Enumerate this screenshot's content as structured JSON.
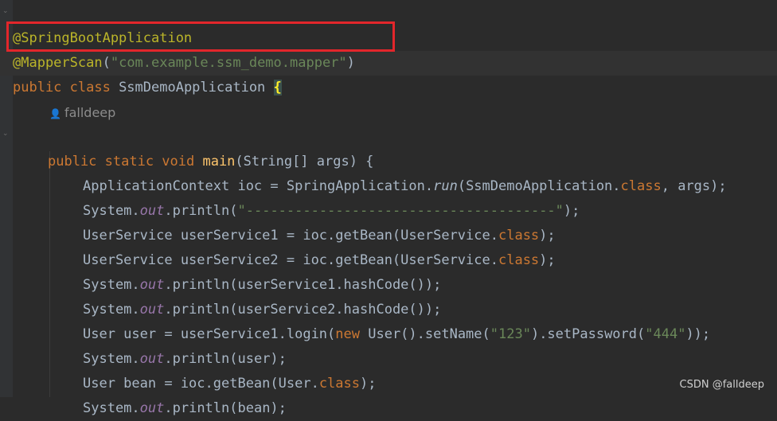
{
  "code": {
    "l1": [
      "@SpringBootApplication"
    ],
    "l2": [
      "@MapperScan",
      "(",
      "\"com.example.ssm_demo.mapper\"",
      ")"
    ],
    "l3": [
      "public class ",
      "SsmDemoApplication ",
      "{"
    ],
    "author": "falldeep",
    "l5": [
      "public static void ",
      "main",
      "(String[] args) {"
    ],
    "l6": [
      "ApplicationContext ioc = SpringApplication.",
      "run",
      "(SsmDemoApplication.",
      "class",
      ", args);"
    ],
    "l7": [
      "System.",
      "out",
      ".println(",
      "\"--------------------------------------\"",
      ");"
    ],
    "l8": [
      "UserService userService1 = ioc.getBean(UserService.",
      "class",
      ");"
    ],
    "l9": [
      "UserService userService2 = ioc.getBean(UserService.",
      "class",
      ");"
    ],
    "l10": [
      "System.",
      "out",
      ".println(userService1.hashCode());"
    ],
    "l11": [
      "System.",
      "out",
      ".println(userService2.hashCode());"
    ],
    "l12": [
      "User user = userService1.login(",
      "new ",
      "User().setName(",
      "\"123\"",
      ").setPassword(",
      "\"444\"",
      "));"
    ],
    "l13": [
      "System.",
      "out",
      ".println(user);"
    ],
    "l14": [
      "User bean = ioc.getBean(User.",
      "class",
      ");"
    ],
    "l15": [
      "System.",
      "out",
      ".println(bean);"
    ]
  },
  "watermark": "CSDN @falldeep",
  "icons": {
    "fold": "fold-marker-icon",
    "author": "person-icon"
  },
  "colors": {
    "background": "#2b2b2b",
    "annotation": "#bbb529",
    "keyword": "#cc7832",
    "string": "#6a8759",
    "method": "#ffc66d",
    "field": "#9876aa",
    "highlight_box": "#e3262b"
  }
}
